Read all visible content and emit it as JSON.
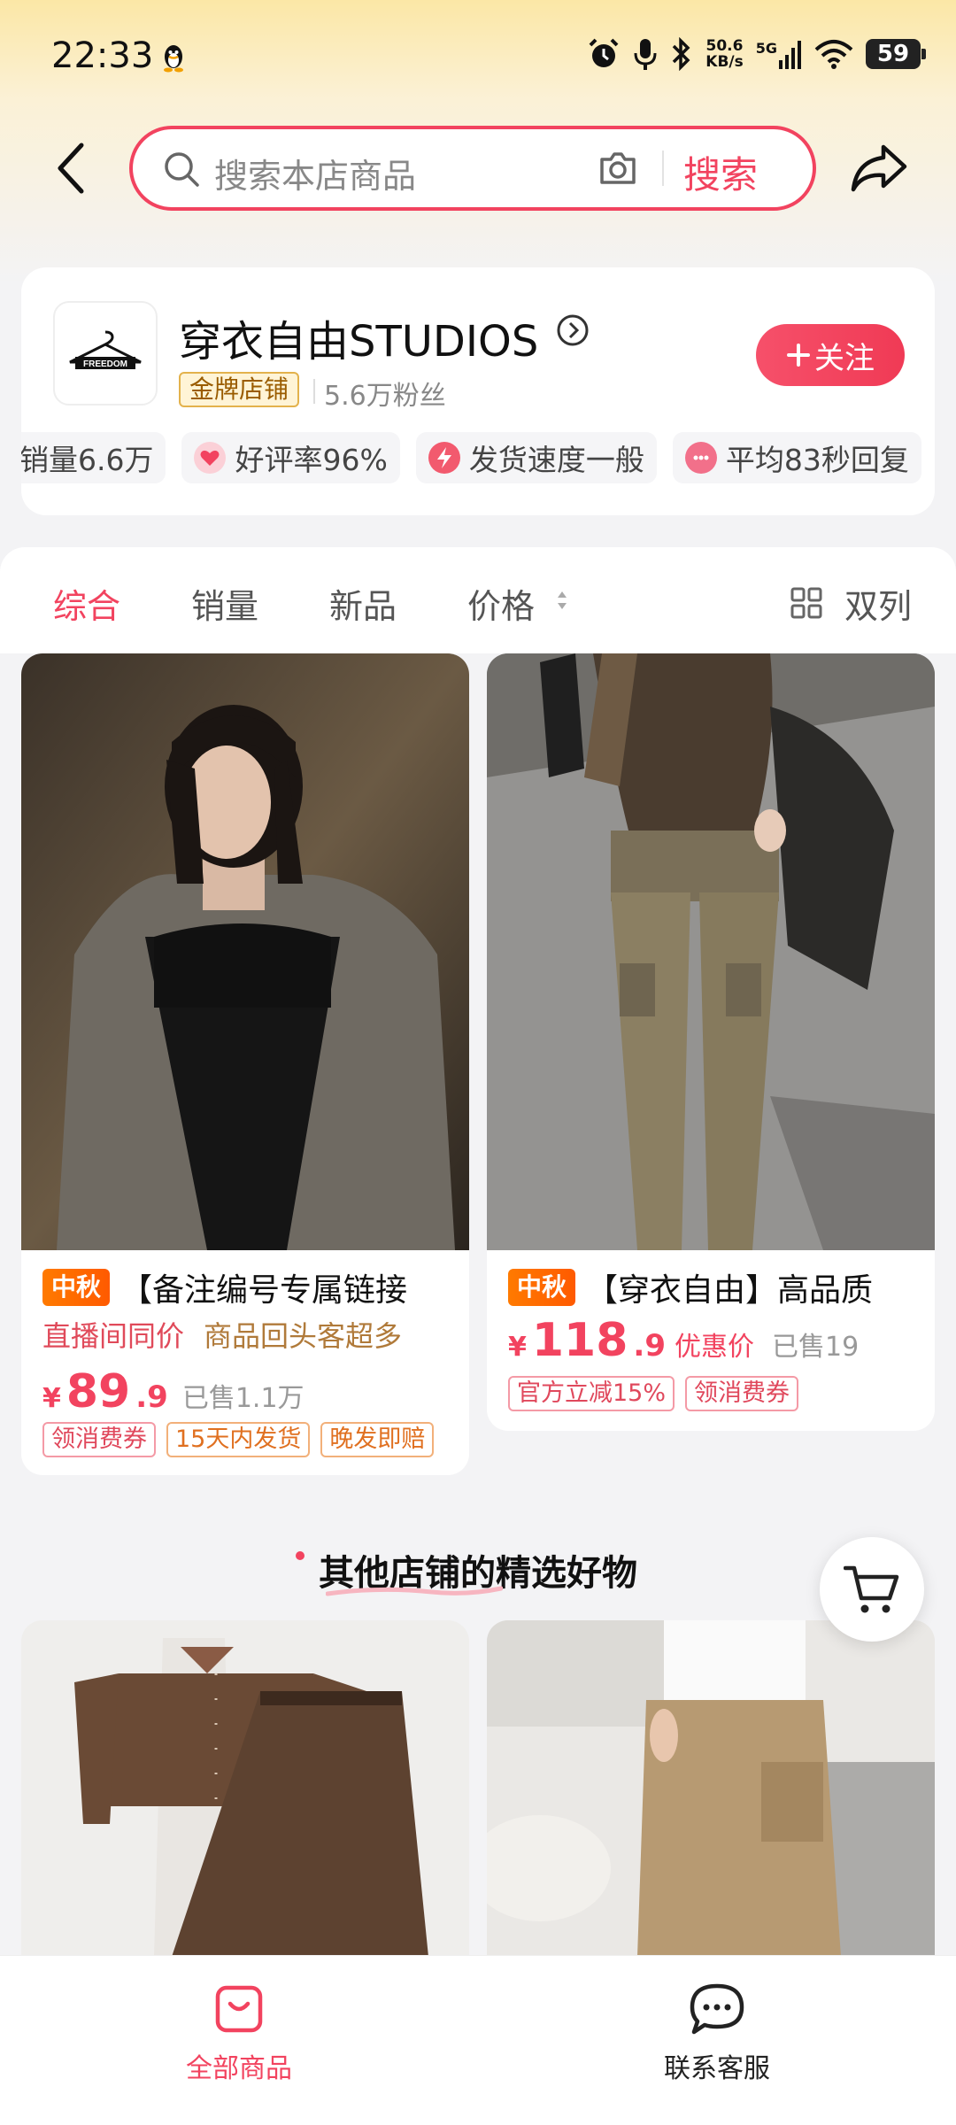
{
  "status_bar": {
    "time": "22:33",
    "net_speed_value": "50.6",
    "net_speed_unit": "KB/s",
    "network": "5G",
    "battery": "59"
  },
  "search": {
    "placeholder": "搜索本店商品",
    "button_label": "搜索"
  },
  "shop": {
    "logo_text": "FREEDOM",
    "name": "穿衣自由STUDIOS",
    "badge": "金牌店铺",
    "fans": "5.6万粉丝",
    "follow_label": "关注",
    "stats": [
      {
        "label": "销量6.6万",
        "icon": "none"
      },
      {
        "label": "好评率96%",
        "icon": "heart-icon"
      },
      {
        "label": "发货速度一般",
        "icon": "lightning-icon"
      },
      {
        "label": "平均83秒回复",
        "icon": "chat-bubble-icon"
      }
    ]
  },
  "tabs": {
    "items": [
      "综合",
      "销量",
      "新品",
      "价格"
    ],
    "active": "综合",
    "layout_label": "双列"
  },
  "products": [
    {
      "tag": "中秋",
      "title": "【备注编号专属链接",
      "sub_red": "直播间同价",
      "sub_brown": "商品回头客超多",
      "price_symbol": "¥",
      "price_int": "89",
      "price_dec": ".9",
      "price_label": "",
      "sold": "已售1.1万",
      "chips": [
        "领消费券",
        "15天内发货",
        "晚发即赔"
      ]
    },
    {
      "tag": "中秋",
      "title": "【穿衣自由】高品质",
      "price_symbol": "¥",
      "price_int": "118",
      "price_dec": ".9",
      "price_label": "优惠价",
      "sold": "已售19",
      "chips": [
        "官方立减15%",
        "领消费券"
      ]
    }
  ],
  "recommend": {
    "title": "其他店铺的精选好物"
  },
  "bottom_nav": {
    "all_products": "全部商品",
    "customer_service": "联系客服"
  },
  "colors": {
    "accent": "#f2435f",
    "orange_tag": "#ff6a00",
    "gold_badge": "#e3b24c"
  }
}
